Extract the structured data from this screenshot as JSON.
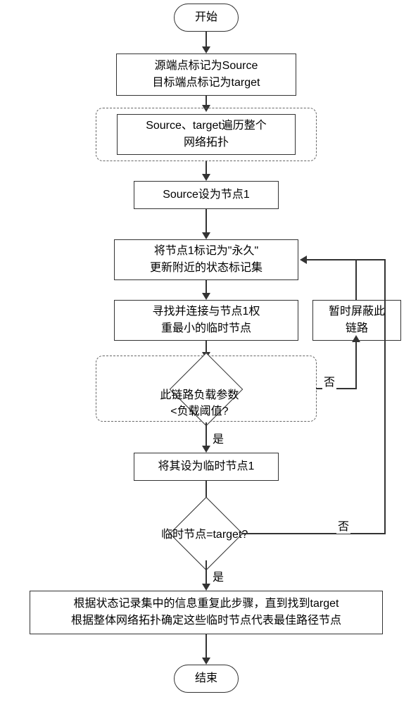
{
  "flowchart": {
    "start": "开始",
    "end": "结束",
    "step_mark_source": "源端点标记为Source\n目标端点标记为target",
    "step_traverse": "Source、target遍历整个\n网络拓扑",
    "step_set_node1": "Source设为节点1",
    "step_mark_permanent": "将节点1标记为\"永久\"\n更新附近的状态标记集",
    "step_find_connect": "寻找并连接与节点1权\n重最小的临时节点",
    "step_block_link": "暂时屏蔽此\n链路",
    "decision_load": "此链路负载参数\n<负载阈值?",
    "step_set_temp_node": "将其设为临时节点1",
    "decision_target": "临时节点=target?",
    "step_final": "根据状态记录集中的信息重复此步骤，直到找到target\n根据整体网络拓扑确定这些临时节点代表最佳路径节点",
    "label_yes": "是",
    "label_no": "否"
  }
}
